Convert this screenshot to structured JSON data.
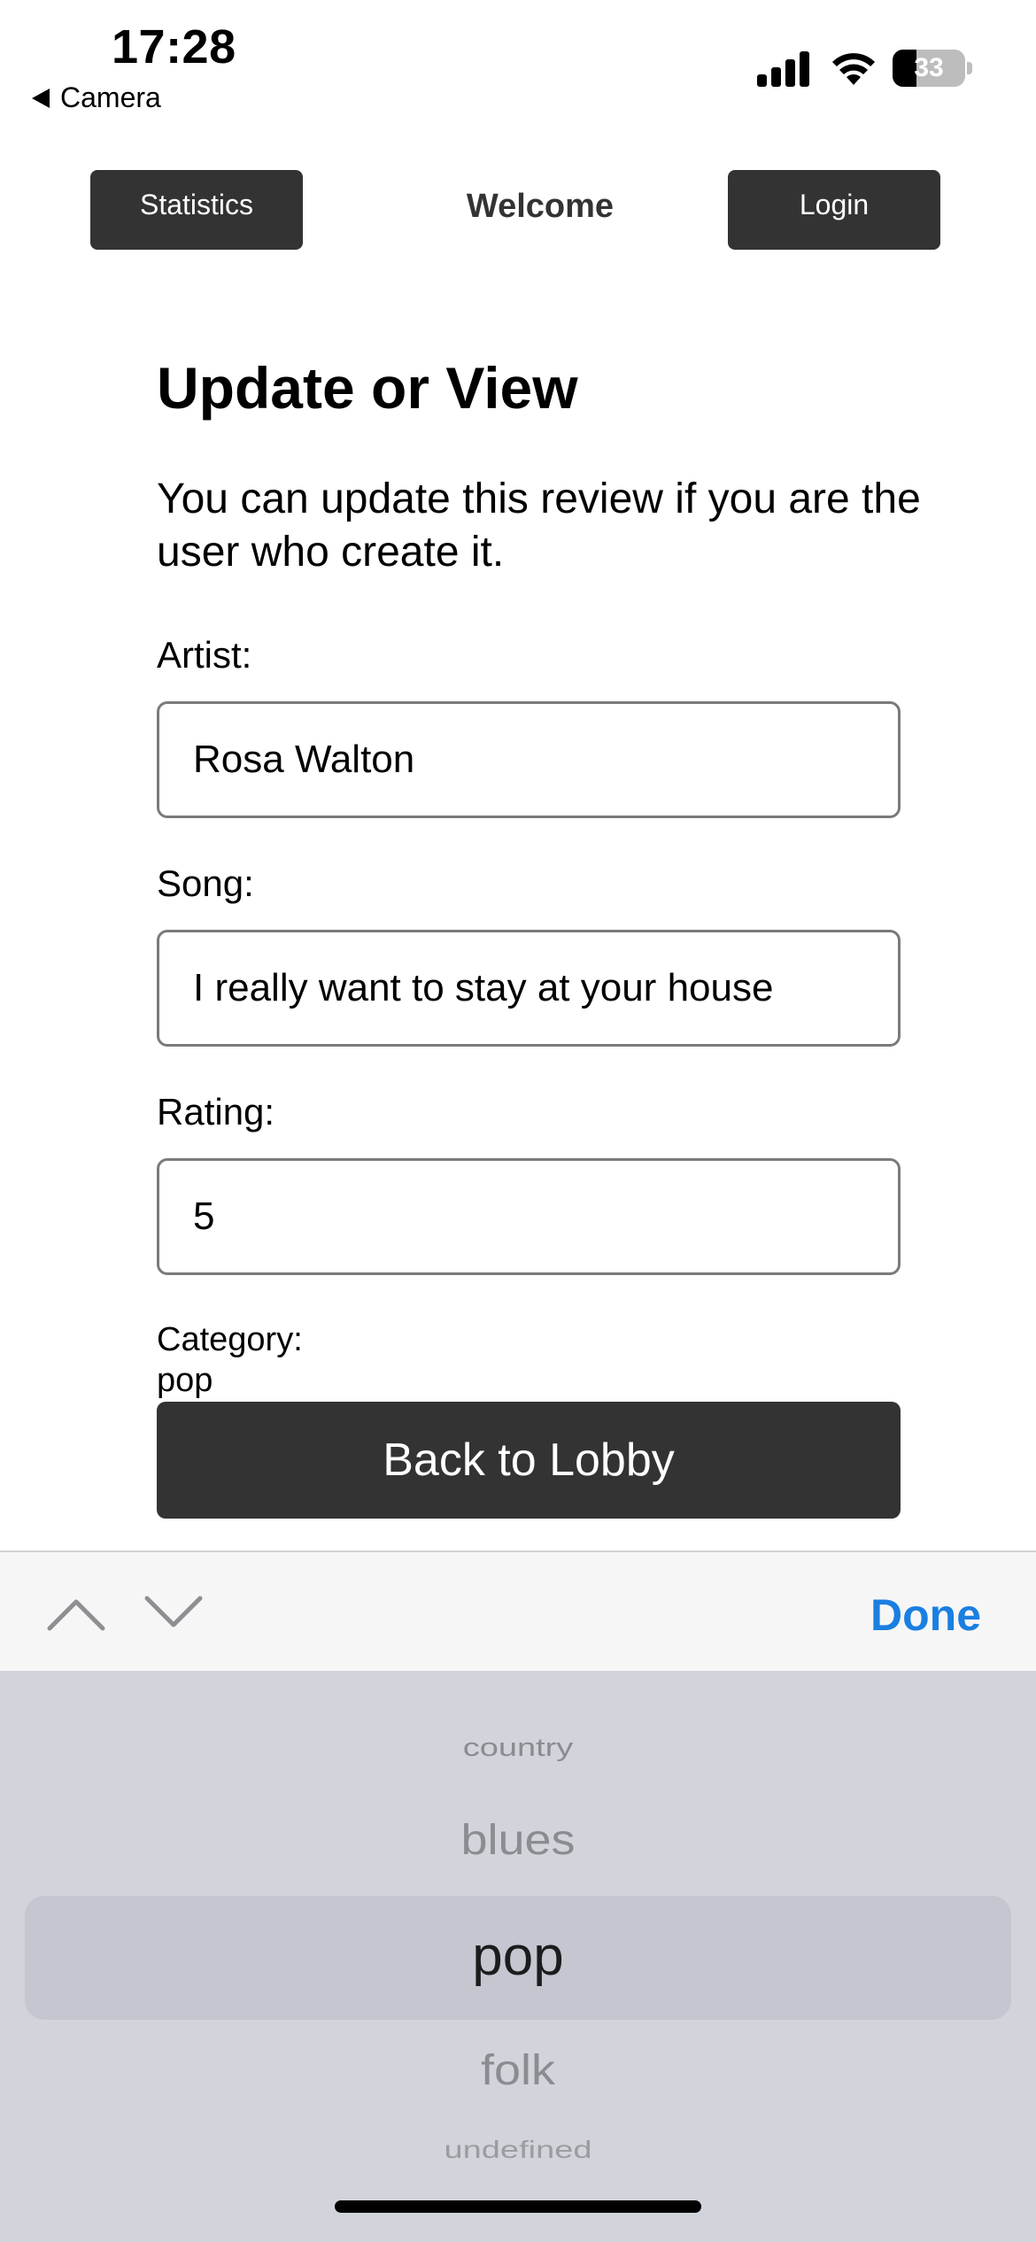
{
  "status_bar": {
    "time": "17:28",
    "back_app": "Camera",
    "battery": "33",
    "battery_level": 0.33
  },
  "nav": {
    "statistics": "Statistics",
    "welcome": "Welcome",
    "login": "Login"
  },
  "form": {
    "title": "Update or View",
    "intro": "You can update this review if you are the user who create it.",
    "artist_label": "Artist:",
    "artist_value": "Rosa Walton",
    "song_label": "Song:",
    "song_value": "I really want to stay at your house",
    "rating_label": "Rating:",
    "rating_value": "5",
    "category_label": "Category:",
    "category_value": "pop",
    "back_button": "Back to Lobby"
  },
  "keyboard_accessory": {
    "done": "Done"
  },
  "picker": {
    "options": [
      "country",
      "blues",
      "pop",
      "folk",
      "undefined"
    ],
    "selected": "pop"
  }
}
